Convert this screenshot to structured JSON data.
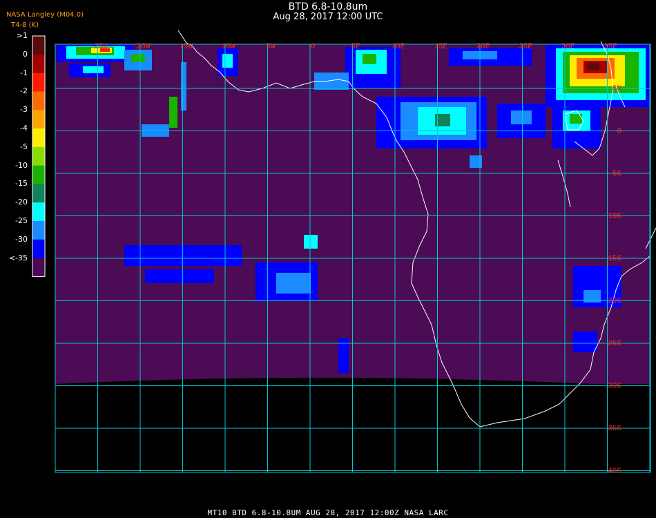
{
  "header": {
    "title": "BTD 6.8-10.8um",
    "subtitle": "Aug 28, 2017 12:00 UTC",
    "org": "NASA Langley (M04.0)",
    "units": "T4-8 (K)"
  },
  "footer": {
    "text": "MT10  BTD 6.8-10.8UM   AUG 28, 2017 12:00Z   NASA LARC"
  },
  "legend": {
    "labels": [
      ">1",
      "0",
      "-1",
      "-2",
      "-3",
      "-4",
      "-5",
      "-10",
      "-15",
      "-20",
      "-25",
      "-30",
      "<-35"
    ],
    "colors": [
      "#5a0c0c",
      "#a40000",
      "#ff1a00",
      "#ff6a00",
      "#ffa500",
      "#ffee00",
      "#88dd00",
      "#18b400",
      "#12825a",
      "#00ffff",
      "#1a8cff",
      "#0000ff",
      "#4a0a55"
    ]
  },
  "map": {
    "lon_labels": [
      "25W",
      "20W",
      "15W",
      "10W",
      "5W",
      "0",
      "5E",
      "10E",
      "15E",
      "20E",
      "25E",
      "30E",
      "35E"
    ],
    "lat_labels": [
      "5N",
      "0",
      "5S",
      "10S",
      "15S",
      "20S",
      "25S",
      "30S",
      "35S",
      "40S"
    ],
    "grid_color": "#00c8d0",
    "label_color": "#ff2a1a",
    "background_color": "#4b0b55",
    "coast_color": "#ffffff"
  }
}
